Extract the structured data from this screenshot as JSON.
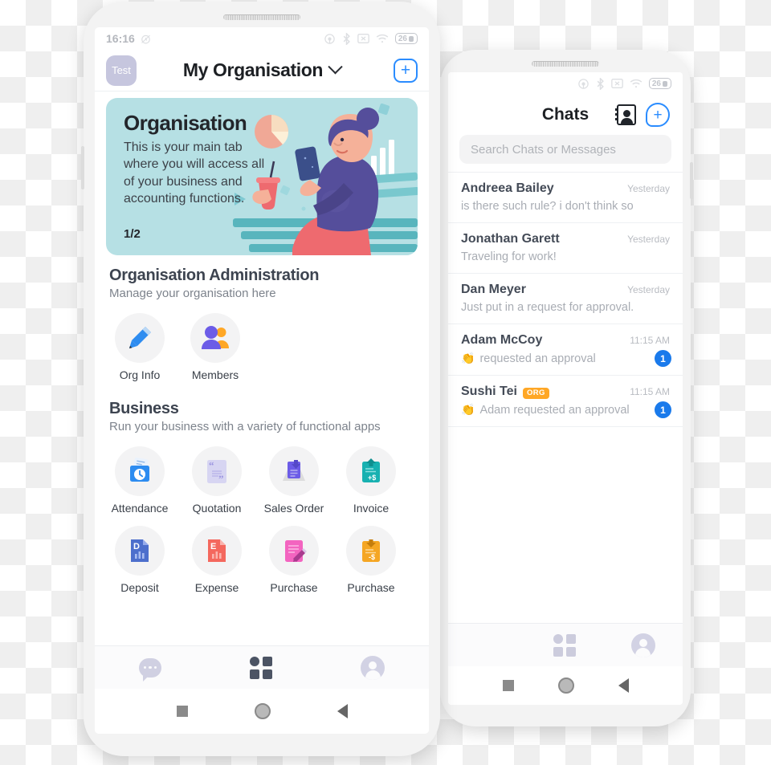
{
  "phone_back": {
    "statusbar": {
      "icons": [
        "cast-icon",
        "bluetooth-icon",
        "no-sim-icon",
        "wifi-icon",
        "battery-icon"
      ],
      "battery": "26"
    },
    "header": {
      "title": "Chats",
      "contacts_icon": "contacts-book-icon",
      "new_chat_icon": "new-chat-plus-icon"
    },
    "search": {
      "placeholder": "Search Chats or Messages"
    },
    "chats": [
      {
        "name": "Andreea Bailey",
        "tag": "",
        "time": "Yesterday",
        "emoji": "",
        "message": "is there such rule? i don't think so",
        "unread": ""
      },
      {
        "name": "Jonathan Garett",
        "tag": "",
        "time": "Yesterday",
        "emoji": "",
        "message": "Traveling for work!",
        "unread": ""
      },
      {
        "name": "Dan Meyer",
        "tag": "",
        "time": "Yesterday",
        "emoji": "",
        "message": "Just put in a request for approval.",
        "unread": ""
      },
      {
        "name": "Adam McCoy",
        "tag": "",
        "time": "11:15 AM",
        "emoji": "👏",
        "message": "requested an approval",
        "unread": "1"
      },
      {
        "name": "Sushi Tei",
        "tag": "ORG",
        "time": "11:15 AM",
        "emoji": "👏",
        "message": "Adam requested an approval",
        "unread": "1"
      }
    ],
    "bottom_nav": [
      {
        "name": "apps-grid",
        "icon": "apps-grid-icon",
        "active": false
      },
      {
        "name": "profile",
        "icon": "profile-avatar-icon",
        "active": false
      }
    ]
  },
  "phone_front": {
    "statusbar": {
      "time": "16:16",
      "alarm_icon": "alarm-off-icon",
      "icons": [
        "cast-icon",
        "bluetooth-icon",
        "no-sim-icon",
        "wifi-icon",
        "battery-icon"
      ],
      "battery": "26"
    },
    "header": {
      "avatar_label": "Test",
      "title": "My Organisation",
      "chevron_icon": "chevron-down-icon",
      "add_icon": "plus-square-icon"
    },
    "banner": {
      "title": "Organisation",
      "body": "This is your main tab where you will access all of your business and accounting functions.",
      "page": "1/2",
      "illustration": "woman-on-bench-with-phone-illustration",
      "bg_color": "#b6e0e4"
    },
    "admin_section": {
      "title": "Organisation Administration",
      "subtitle": "Manage your organisation here",
      "tiles": [
        {
          "label": "Org Info",
          "icon": "pencil-icon"
        },
        {
          "label": "Members",
          "icon": "people-icon"
        }
      ]
    },
    "business_section": {
      "title": "Business",
      "subtitle": "Run your business with a variety of functional apps",
      "tiles": [
        {
          "label": "Attendance",
          "icon": "attendance-clock-icon"
        },
        {
          "label": "Quotation",
          "icon": "quotation-marks-icon"
        },
        {
          "label": "Sales Order",
          "icon": "sales-order-down-arrow-icon"
        },
        {
          "label": "Invoice",
          "icon": "invoice-plus-dollar-icon"
        },
        {
          "label": "Deposit",
          "icon": "deposit-d-document-icon"
        },
        {
          "label": "Expense",
          "icon": "expense-e-document-icon"
        },
        {
          "label": "Purchase",
          "icon": "purchase-pencil-icon"
        },
        {
          "label": "Purchase",
          "icon": "purchase-minus-dollar-icon"
        }
      ]
    },
    "bottom_nav": [
      {
        "name": "chats",
        "icon": "chat-bubble-icon",
        "active": false
      },
      {
        "name": "apps-grid",
        "icon": "apps-grid-icon",
        "active": true
      },
      {
        "name": "profile",
        "icon": "profile-avatar-icon",
        "active": false
      }
    ]
  },
  "android_nav": {
    "recent": "square-icon",
    "home": "circle-icon",
    "back": "triangle-back-icon"
  }
}
